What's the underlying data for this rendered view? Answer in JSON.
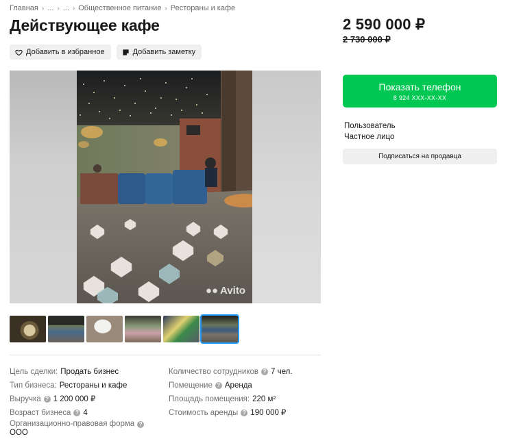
{
  "breadcrumbs": [
    {
      "label": "Главная"
    },
    {
      "label": "..."
    },
    {
      "label": "..."
    },
    {
      "label": "Общественное питание"
    },
    {
      "label": "Рестораны и кафе"
    }
  ],
  "title": "Действующее кафе",
  "actions": {
    "favorite_label": "Добавить в избранное",
    "note_label": "Добавить заметку"
  },
  "price": "2 590 000 ₽",
  "old_price": "2 730 000 ₽",
  "phone_button": {
    "label": "Показать телефон",
    "number": "8 924 XXX-XX-XX",
    "color": "#00c853"
  },
  "seller": {
    "name": "Пользователь",
    "type": "Частное лицо",
    "subscribe_label": "Подписаться на продавца"
  },
  "gallery": {
    "watermark": "Avito"
  },
  "params_left": [
    {
      "key": "Цель сделки:",
      "value": "Продать бизнес",
      "help": false
    },
    {
      "key": "Тип бизнеса:",
      "value": "Рестораны и кафе",
      "help": false
    },
    {
      "key": "Выручка",
      "value": "1 200 000 ₽",
      "help": true
    },
    {
      "key": "Возраст бизнеса",
      "value": "4",
      "help": true
    },
    {
      "key": "Организационно-правовая форма",
      "value": "ООО",
      "help": true
    }
  ],
  "params_right": [
    {
      "key": "Количество сотрудников",
      "value": "7 чел.",
      "help": true
    },
    {
      "key": "Помещение",
      "value": "Аренда",
      "help": true
    },
    {
      "key": "Площадь помещения:",
      "value": "220 м²",
      "help": false
    },
    {
      "key": "Стоимость аренды",
      "value": "190 000 ₽",
      "help": true
    }
  ]
}
